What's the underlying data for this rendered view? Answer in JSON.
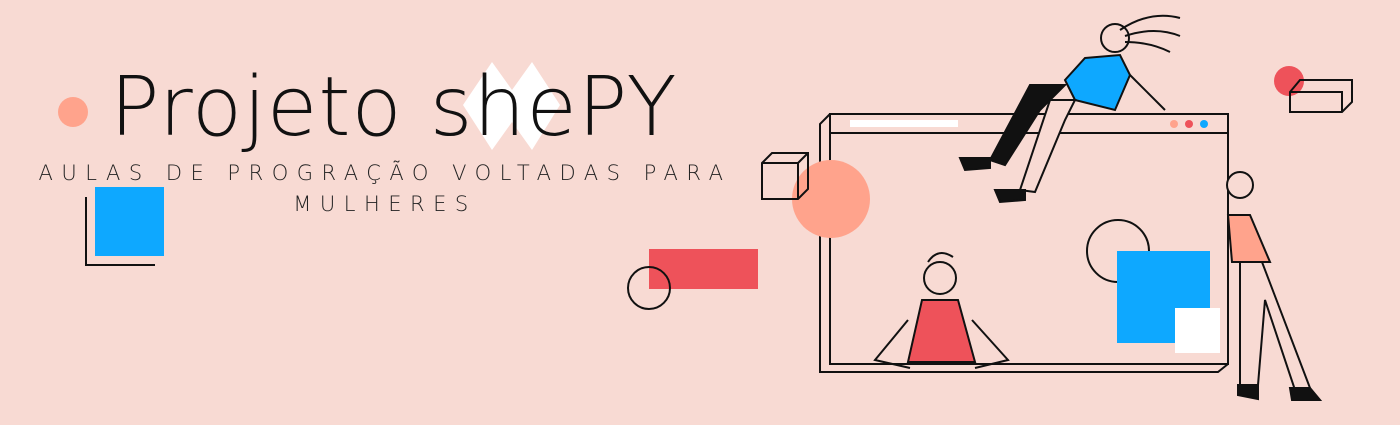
{
  "banner": {
    "title": "Projeto shePY",
    "subtitle_line1": "AULAS DE PROGRAÇÃO VOLTADAS PARA",
    "subtitle_line2": "MULHERES"
  },
  "colors": {
    "background": "#F8DAD3",
    "salmon": "#FFA38C",
    "blue": "#0EA8FF",
    "red": "#EE525A"
  }
}
